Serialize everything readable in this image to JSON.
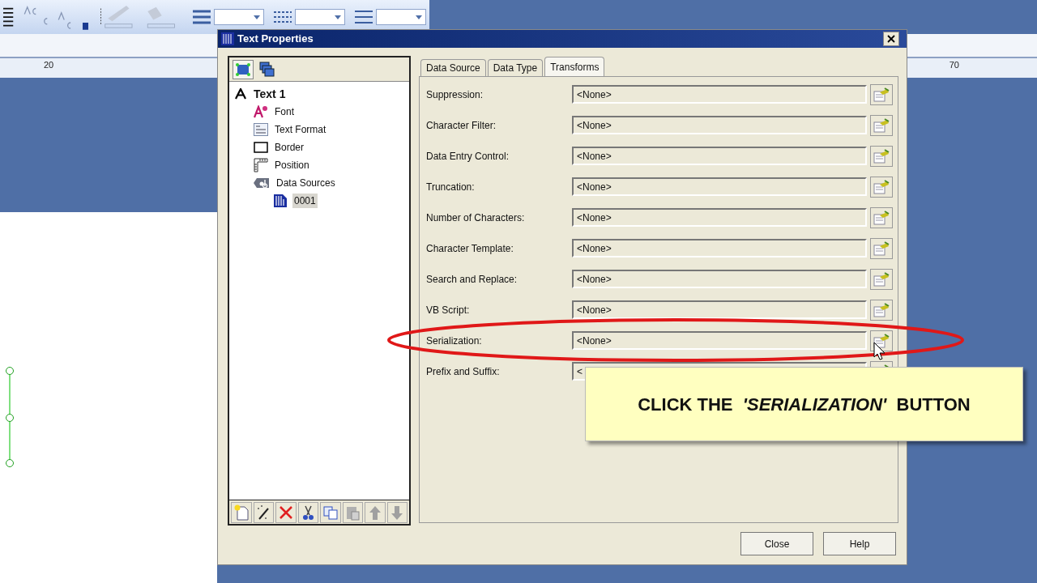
{
  "ruler": {
    "labels": [
      "20",
      "70"
    ]
  },
  "window": {
    "title": "Text Properties"
  },
  "tree": [
    {
      "label": "Text 1",
      "kind": "object",
      "selected": false,
      "children": [
        {
          "label": "Font",
          "kind": "font",
          "selected": false
        },
        {
          "label": "Text Format",
          "kind": "format",
          "selected": false
        },
        {
          "label": "Border",
          "kind": "border",
          "selected": false
        },
        {
          "label": "Position",
          "kind": "position",
          "selected": false
        },
        {
          "label": "Data Sources",
          "kind": "sources",
          "selected": false,
          "children": [
            {
              "label": "0001",
              "kind": "source",
              "selected": true
            }
          ]
        }
      ]
    }
  ],
  "tabs": [
    {
      "label": "Data Source",
      "selected": false
    },
    {
      "label": "Data Type",
      "selected": false
    },
    {
      "label": "Transforms",
      "selected": true
    }
  ],
  "transforms": [
    {
      "label": "Suppression:",
      "value": "<None>"
    },
    {
      "label": "Character Filter:",
      "value": "<None>"
    },
    {
      "label": "Data Entry Control:",
      "value": "<None>"
    },
    {
      "label": "Truncation:",
      "value": "<None>"
    },
    {
      "label": "Number of Characters:",
      "value": "<None>"
    },
    {
      "label": "Character Template:",
      "value": "<None>"
    },
    {
      "label": "Search and Replace:",
      "value": "<None>"
    },
    {
      "label": "VB Script:",
      "value": "<None>"
    },
    {
      "label": "Serialization:",
      "value": "<None>"
    },
    {
      "label": "Prefix and Suffix:",
      "value": "<"
    }
  ],
  "buttons": [
    "Close",
    "Help"
  ],
  "callout": {
    "text": "CLICK THE  *'SERIALIZATION'*  BUTTON"
  }
}
